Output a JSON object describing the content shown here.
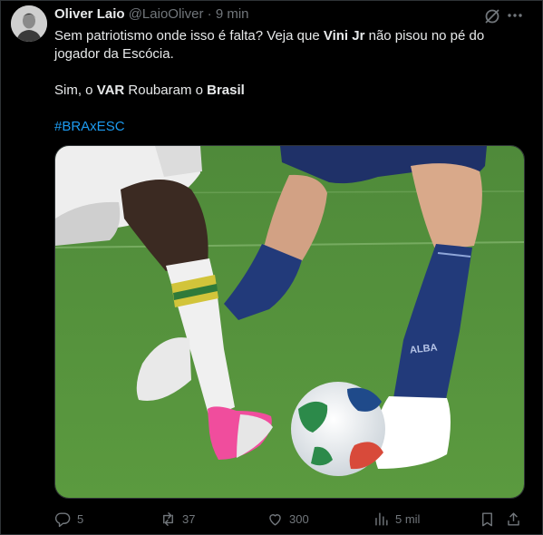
{
  "tweet": {
    "author_name": "Oliver Laio",
    "handle": "@LaioOliver",
    "separator": "·",
    "time": "9 min",
    "text": {
      "line1_a": "Sem patriotismo onde isso é falta? Veja que ",
      "line1_bold": "Vini Jr",
      "line1_b": " não pisou no pé do jogador da Escócia.",
      "line2_a": "Sim, o ",
      "line2_bold1": "VAR",
      "line2_b": " Roubaram o ",
      "line2_bold2": "Brasil",
      "hashtag": "#BRAxESC"
    },
    "media": {
      "jersey_text": "ALBA"
    },
    "actions": {
      "replies": "5",
      "reposts": "37",
      "likes": "300",
      "views": "5 mil"
    }
  },
  "icons": [
    "grok-icon",
    "more-icon",
    "reply-icon",
    "repost-icon",
    "like-icon",
    "views-icon",
    "bookmark-icon",
    "share-icon"
  ],
  "colors": {
    "background": "#000000",
    "text": "#e7e9ea",
    "secondary": "#71767b",
    "link": "#1d9bf0",
    "border": "#2f3336"
  }
}
